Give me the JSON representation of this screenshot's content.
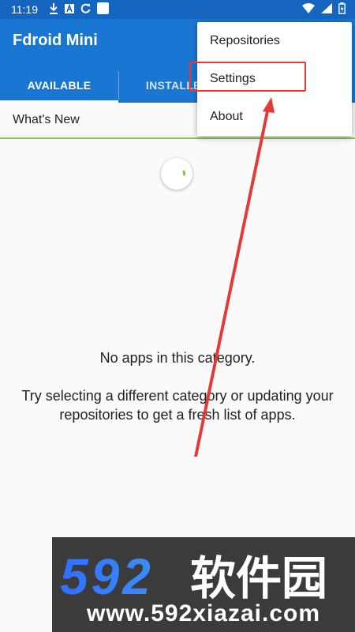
{
  "status_bar": {
    "time": "11:19",
    "left_icons": [
      "download-icon",
      "a-box-icon",
      "sync-icon",
      "white-square-icon"
    ],
    "right_icons": [
      "wifi-icon",
      "signal-icon",
      "battery-icon"
    ]
  },
  "app_bar": {
    "title": "Fdroid Mini",
    "tabs": [
      {
        "label": "AVAILABLE",
        "active": true
      },
      {
        "label": "INSTALLED",
        "active": false
      }
    ]
  },
  "category": {
    "selected": "What's New"
  },
  "empty_state": {
    "title": "No apps in this category.",
    "hint": "Try selecting a different category or updating your repositories to get a fresh list of apps."
  },
  "overflow_menu": {
    "items": [
      {
        "label": "Repositories"
      },
      {
        "label": "Settings",
        "highlighted": true
      },
      {
        "label": "About"
      }
    ]
  },
  "annotation": {
    "color": "#e53935",
    "target": "Settings"
  },
  "watermark": {
    "logo": "592软件园",
    "url": "www.592xiazai.com"
  },
  "colors": {
    "status_bar": "#1565c0",
    "app_bar": "#1976d2",
    "category_underline": "#8bc34a",
    "spinner": "#8bc34a"
  }
}
